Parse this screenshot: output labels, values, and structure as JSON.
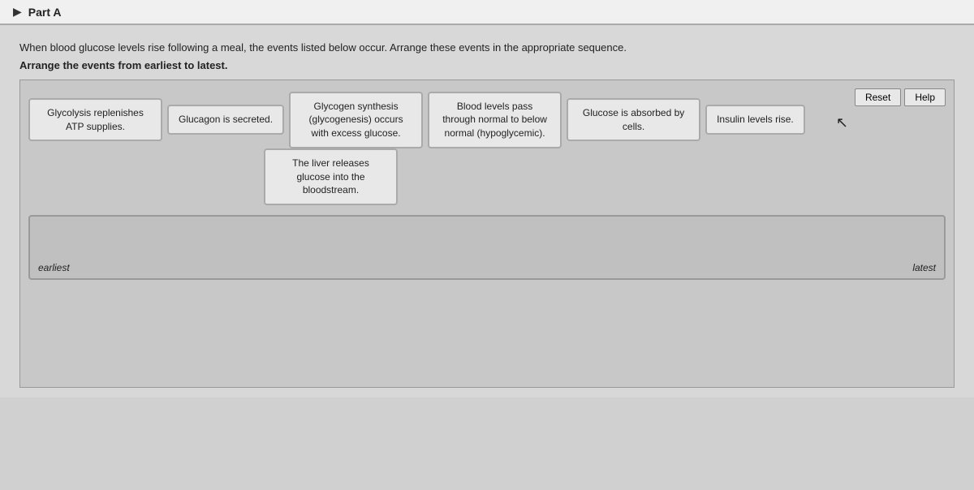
{
  "header": {
    "arrow": "▶",
    "part_label": "Part A"
  },
  "instructions": {
    "line1": "When blood glucose levels rise following a meal, the events listed below occur. Arrange these events in the appropriate sequence.",
    "line2": "Arrange the events from earliest to latest."
  },
  "buttons": {
    "reset": "Reset",
    "help": "Help"
  },
  "event_cards": [
    {
      "id": "card1",
      "text": "Glycolysis replenishes ATP supplies."
    },
    {
      "id": "card2",
      "text": "Glucagon is secreted."
    },
    {
      "id": "card3",
      "text": "Glycogen synthesis (glycogenesis) occurs with excess glucose."
    },
    {
      "id": "card4",
      "text": "Blood levels pass through normal to below normal (hypoglycemic)."
    },
    {
      "id": "card5",
      "text": "Glucose is absorbed by cells."
    },
    {
      "id": "card6",
      "text": "Insulin levels rise."
    },
    {
      "id": "card7",
      "text": "The liver releases glucose into the bloodstream."
    }
  ],
  "drop_zone": {
    "label_left": "earliest",
    "label_right": "latest"
  }
}
